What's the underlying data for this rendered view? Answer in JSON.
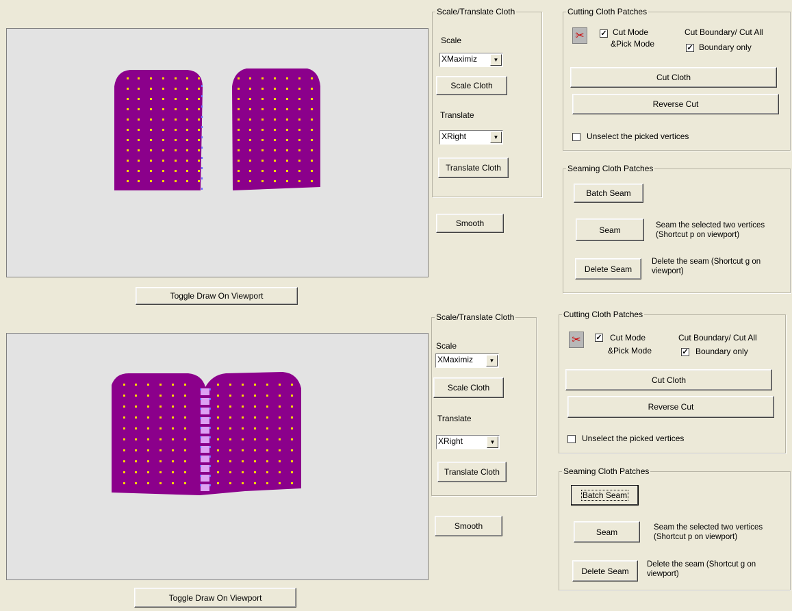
{
  "viewport_button": "Toggle Draw On Viewport",
  "scale_translate": {
    "legend": "Scale/Translate Cloth",
    "scale_label": "Scale",
    "scale_value": "XMaximiz",
    "scale_button": "Scale Cloth",
    "translate_label": "Translate",
    "translate_value": "XRight",
    "translate_button": "Translate Cloth"
  },
  "smooth_button": "Smooth",
  "cutting": {
    "legend": "Cutting Cloth Patches",
    "cut_mode_line1": "Cut Mode",
    "cut_mode_line2": "&Pick Mode",
    "cut_mode_checked": true,
    "cut_boundary_label": "Cut Boundary/ Cut All",
    "boundary_only_label": "Boundary only",
    "boundary_only_checked": true,
    "cut_button": "Cut Cloth",
    "reverse_button": "Reverse Cut",
    "unselect_label": "Unselect the picked vertices",
    "unselect_checked": false
  },
  "seaming": {
    "legend": "Seaming Cloth Patches",
    "batch_button": "Batch Seam",
    "seam_button": "Seam",
    "seam_desc_line1": "Seam the selected two vertices",
    "seam_desc_line2": "(Shortcut p on viewport)",
    "delete_button": "Delete Seam",
    "delete_desc_line1": "Delete the seam (Shortcut g on",
    "delete_desc_line2": "viewport)"
  },
  "colors": {
    "cloth": "#8b008b",
    "vertex": "#ffd700",
    "seam": "#7070ff",
    "viewport_bg": "#e3e3e3",
    "window_bg": "#ece9d8"
  },
  "icons": {
    "scissors": "scissors-icon",
    "dropdown": "chevron-down-icon",
    "check": "check-icon"
  }
}
